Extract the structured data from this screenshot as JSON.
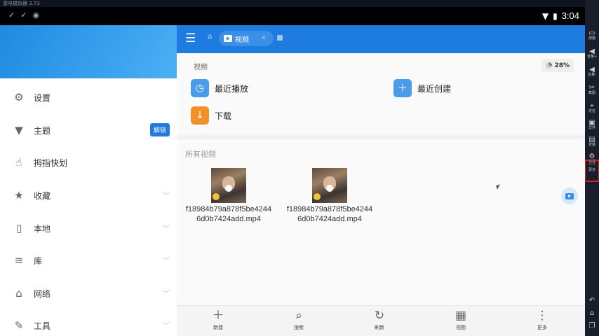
{
  "emulator": {
    "title": "雷电模拟器 3.73",
    "toolbar": [
      "按键",
      "音量+",
      "音量-",
      "截图",
      "定位",
      "文件",
      "安装",
      "设置",
      "更多"
    ]
  },
  "statusbar": {
    "time": "3:04"
  },
  "drawer": {
    "items": [
      {
        "label": "设置",
        "icon": "gear-icon"
      },
      {
        "label": "主题",
        "icon": "shirt-icon",
        "badge": "解锁"
      },
      {
        "label": "拇指快划",
        "icon": "swipe-icon"
      },
      {
        "label": "收藏",
        "icon": "star-icon"
      },
      {
        "label": "本地",
        "icon": "phone-icon"
      },
      {
        "label": "库",
        "icon": "layers-icon"
      },
      {
        "label": "网络",
        "icon": "network-icon"
      },
      {
        "label": "工具",
        "icon": "wrench-icon"
      }
    ]
  },
  "appbar": {
    "breadcrumb_label": "视频"
  },
  "main": {
    "section_title": "视频",
    "storage_usage": "28%",
    "storage_fraction": 0.28,
    "shortcuts": [
      {
        "label": "最近播放",
        "icon": "clock-icon",
        "color": "#4a9be8"
      },
      {
        "label": "最近创建",
        "icon": "plus-icon",
        "color": "#4a9be8"
      },
      {
        "label": "下载",
        "icon": "download-icon",
        "color": "#f2912b"
      }
    ],
    "all_videos_label": "所有视频",
    "files": [
      {
        "name_line1": "f18984b79a878f5be4244",
        "name_line2": "6d0b7424add.mp4"
      },
      {
        "name_line1": "f18984b79a878f5be4244",
        "name_line2": "6d0b7424add.mp4"
      }
    ]
  },
  "bottombar": {
    "items": [
      {
        "label": "新建",
        "icon": "plus-icon"
      },
      {
        "label": "搜索",
        "icon": "search-icon"
      },
      {
        "label": "刷新",
        "icon": "refresh-icon"
      },
      {
        "label": "视图",
        "icon": "grid-icon"
      },
      {
        "label": "更多",
        "icon": "more-vertical-icon"
      }
    ]
  }
}
